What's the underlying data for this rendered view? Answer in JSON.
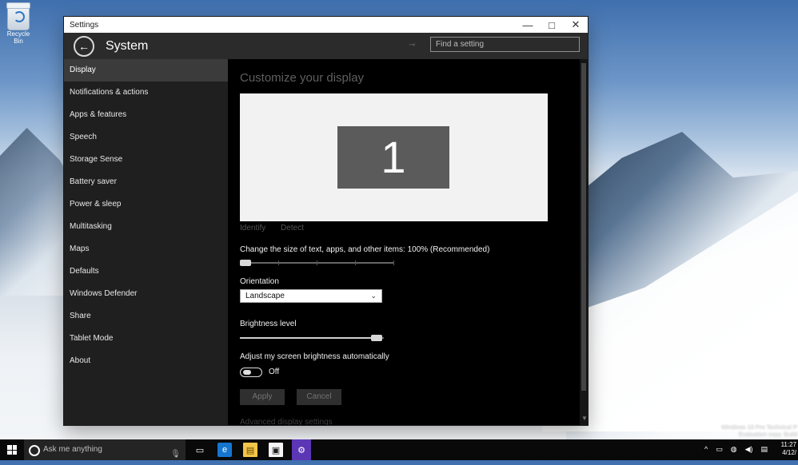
{
  "desktop": {
    "icons": [
      {
        "label": "Recycle Bin"
      }
    ],
    "watermark": {
      "line1": "Windows 10 Pro Technical P",
      "line2": "Evaluation copy. Build"
    }
  },
  "window": {
    "title": "Settings",
    "controls": {
      "minimize": "—",
      "maximize": "□",
      "close": "✕"
    },
    "header": {
      "title": "System",
      "pin_icon": "pin-icon",
      "search_placeholder": "Find a setting"
    },
    "sidebar": {
      "items": [
        {
          "label": "Display",
          "active": true
        },
        {
          "label": "Notifications & actions"
        },
        {
          "label": "Apps & features"
        },
        {
          "label": "Speech"
        },
        {
          "label": "Storage Sense"
        },
        {
          "label": "Battery saver"
        },
        {
          "label": "Power & sleep"
        },
        {
          "label": "Multitasking"
        },
        {
          "label": "Maps"
        },
        {
          "label": "Defaults"
        },
        {
          "label": "Windows Defender"
        },
        {
          "label": "Share"
        },
        {
          "label": "Tablet Mode"
        },
        {
          "label": "About"
        }
      ]
    },
    "content": {
      "section_title": "Customize your display",
      "preview": {
        "monitor_label": "1"
      },
      "links": {
        "identify": "Identify",
        "detect": "Detect"
      },
      "scale": {
        "label": "Change the size of text, apps, and other items: 100% (Recommended)",
        "value_percent": 0
      },
      "orientation": {
        "label": "Orientation",
        "selected": "Landscape"
      },
      "brightness": {
        "label": "Brightness level",
        "value_percent": 100
      },
      "auto_brightness": {
        "label": "Adjust my screen brightness automatically",
        "state": "Off"
      },
      "buttons": {
        "apply": "Apply",
        "cancel": "Cancel"
      },
      "advanced_link": "Advanced display settings"
    }
  },
  "taskbar": {
    "search_text": "Ask me anything",
    "apps": [
      {
        "name": "task-view",
        "symbol": "▭"
      },
      {
        "name": "edge",
        "symbol": "e"
      },
      {
        "name": "file-explorer",
        "symbol": "▤"
      },
      {
        "name": "store",
        "symbol": "▣"
      },
      {
        "name": "settings",
        "symbol": "⚙"
      }
    ],
    "tray_icons": [
      "^",
      "▭",
      "◍",
      "◀)",
      "▤"
    ],
    "clock": {
      "time": "11:27",
      "date": "4/12/"
    }
  }
}
